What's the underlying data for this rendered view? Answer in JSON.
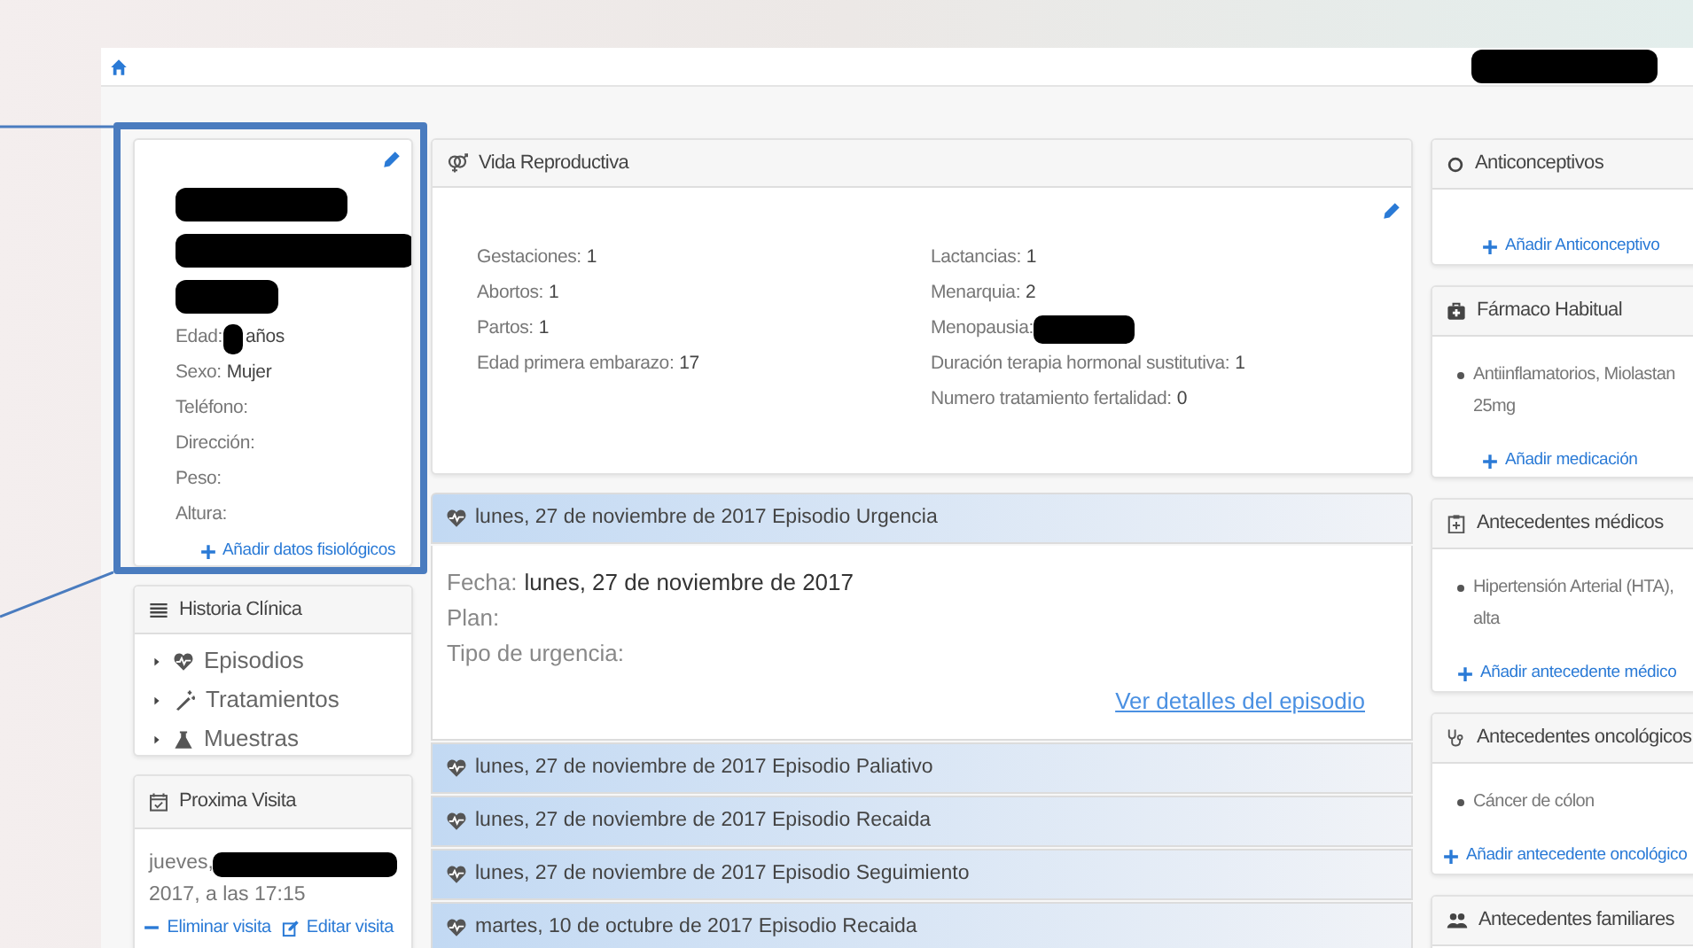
{
  "top_bar": {
    "user": {
      "kind": "redaction"
    }
  },
  "patient_card": {
    "name_block": [
      {
        "kind": "redaction"
      },
      {
        "kind": "redaction"
      },
      {
        "kind": "redaction"
      }
    ],
    "fields": [
      {
        "label": "Edad:",
        "value": "años",
        "redacted": true
      },
      {
        "label": "Sexo:",
        "value": "Mujer",
        "redacted": false
      },
      {
        "label": "Teléfono:",
        "redacted": false
      },
      {
        "label": "Dirección:",
        "redacted": false
      },
      {
        "label": "Peso:",
        "redacted": false
      },
      {
        "label": "Altura:",
        "redacted": false
      }
    ],
    "add_link": "Añadir datos fisiológicos"
  },
  "historia_clinica": {
    "title": "Historia Clínica",
    "items": [
      {
        "label": "Episodios",
        "expanded": false
      },
      {
        "label": "Tratamientos",
        "expanded": false
      },
      {
        "label": "Muestras",
        "expanded": false
      }
    ]
  },
  "proxima_visita": {
    "title": "Proxima Visita",
    "date_start": "jueves,",
    "date_end": "2017, a las 17:15",
    "actions": [
      "Eliminar visita",
      "Editar visita"
    ]
  },
  "vida_reproductiva": {
    "title": "Vida Reproductiva",
    "columns": [
      [
        {
          "label": "Gestaciones:",
          "value": "1",
          "redacted": false
        },
        {
          "label": "Abortos:",
          "value": "1",
          "redacted": false
        },
        {
          "label": "Partos:",
          "value": "1",
          "redacted": false
        },
        {
          "label": "Edad primera embarazo:",
          "value": "17",
          "redacted": false
        }
      ],
      [
        {
          "label": "Lactancias:",
          "value": "1",
          "redacted": false
        },
        {
          "label": "Menarquia:",
          "value": "2",
          "redacted": false
        },
        {
          "label": "Menopausia:",
          "redacted": true
        },
        {
          "label": "Duración terapia hormonal sustitutiva:",
          "value": "1",
          "redacted": false
        },
        {
          "label": "Numero tratamiento fertalidad:",
          "value": "0",
          "redacted": false
        }
      ]
    ]
  },
  "episodes": [
    {
      "title": "lunes, 27 de noviembre de 2017 Episodio Urgencia",
      "expanded": true,
      "details": [
        {
          "label": "Fecha:",
          "value": "lunes, 27 de noviembre de 2017"
        },
        {
          "label": "Plan:"
        },
        {
          "label": "Tipo de urgencia:"
        }
      ],
      "link": "Ver detalles del episodio"
    },
    {
      "title": "lunes, 27 de noviembre de 2017 Episodio Paliativo",
      "expanded": false
    },
    {
      "title": "lunes, 27 de noviembre de 2017 Episodio Recaida",
      "expanded": false
    },
    {
      "title": "lunes, 27 de noviembre de 2017 Episodio Seguimiento",
      "expanded": false
    },
    {
      "title": "martes, 10 de octubre de 2017 Episodio Recaida",
      "expanded": false
    }
  ],
  "right_panels": [
    {
      "title": "Anticonceptivos",
      "add_link": "Añadir Anticonceptivo"
    },
    {
      "title": "Fármaco Habitual",
      "items": [
        "Antiinflamatorios, Miolastan",
        "25mg"
      ],
      "add_link": "Añadir medicación"
    },
    {
      "title": "Antecedentes médicos",
      "items": [
        "Hipertensión Arterial (HTA),",
        "alta"
      ],
      "add_link": "Añadir antecedente médico"
    },
    {
      "title": "Antecedentes oncológicos",
      "items": [
        "Cáncer de cólon"
      ],
      "add_link": "Añadir antecedente oncológico"
    },
    {
      "title": "Antecedentes familiares"
    }
  ]
}
